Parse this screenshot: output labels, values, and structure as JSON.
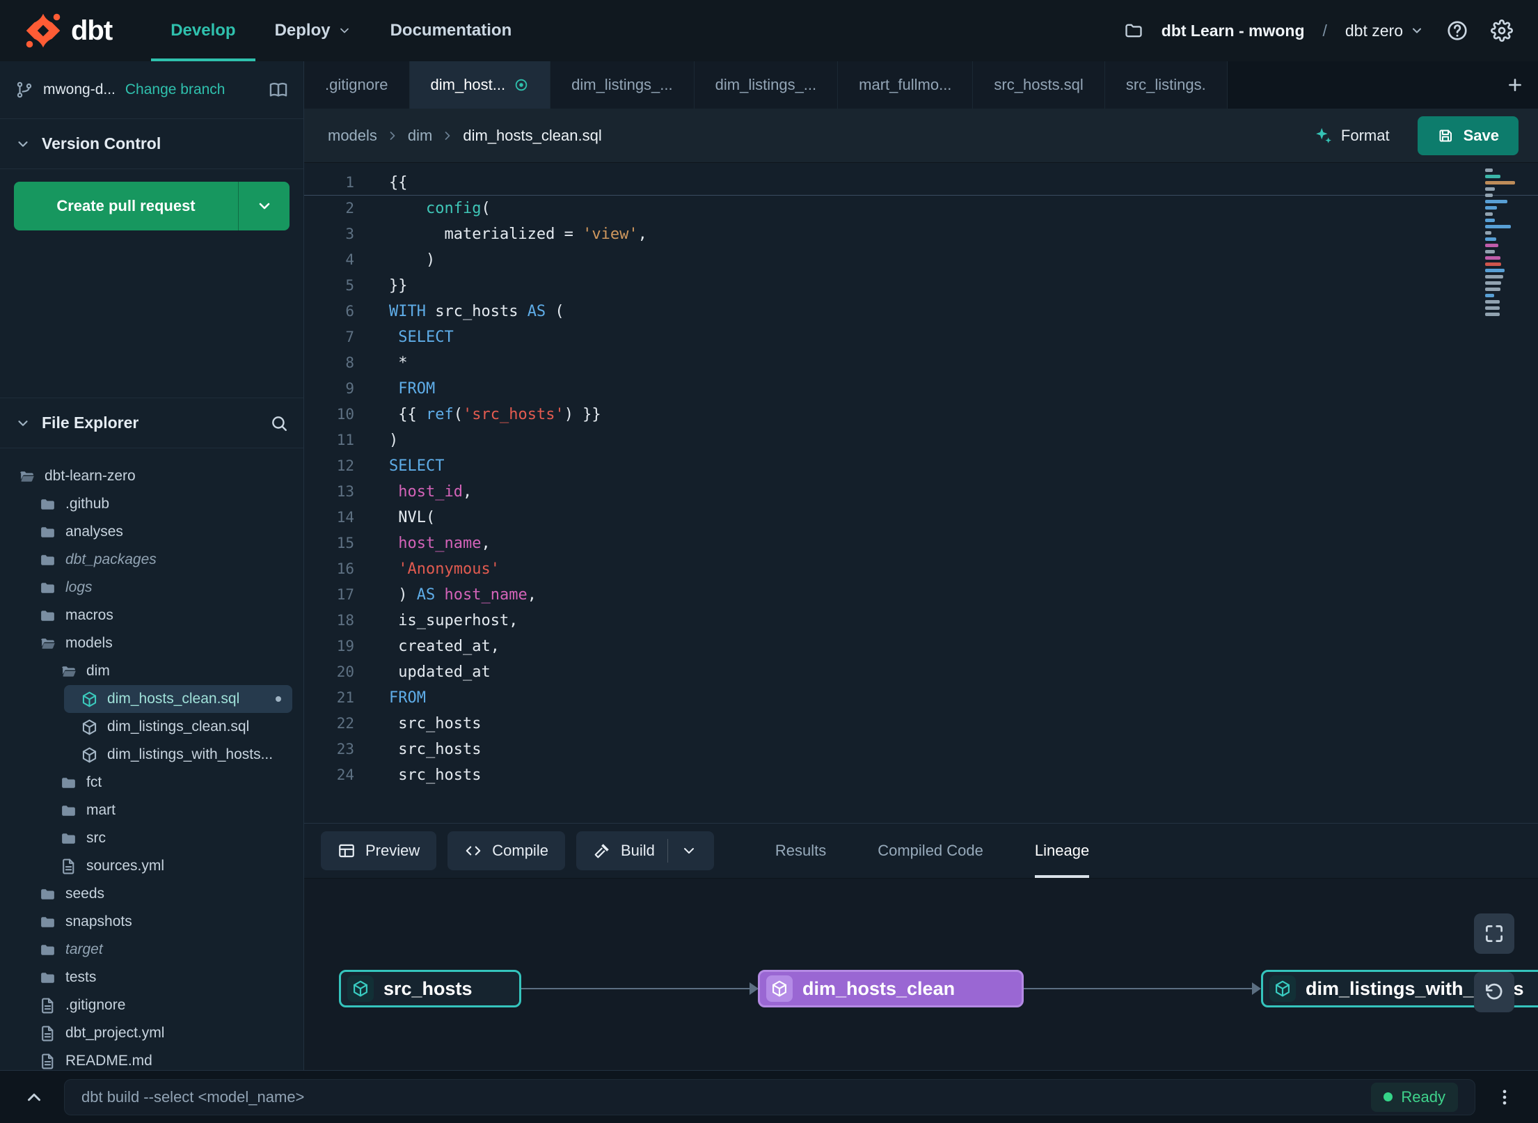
{
  "colors": {
    "accent_teal": "#2fc0ad",
    "logo_orange": "#ff5c35",
    "pr_green": "#17975f",
    "save_teal": "#0d7c6c",
    "node_purple": "#9a67d3",
    "node_teal_border": "#35c4bd",
    "ready_green": "#35d488"
  },
  "navbar": {
    "logo_text": "dbt",
    "menu": [
      {
        "label": "Develop",
        "active": true
      },
      {
        "label": "Deploy",
        "dropdown": true
      },
      {
        "label": "Documentation"
      }
    ],
    "project": "dbt Learn - mwong",
    "separator": "/",
    "env": "dbt zero"
  },
  "sidebar": {
    "branch": {
      "name": "mwong-d...",
      "change_label": "Change branch"
    },
    "version_control_label": "Version Control",
    "create_pr_label": "Create pull request",
    "file_explorer_label": "File Explorer",
    "tree": [
      {
        "label": "dbt-learn-zero",
        "type": "folder-open",
        "level": 0
      },
      {
        "label": ".github",
        "type": "folder",
        "level": 1
      },
      {
        "label": "analyses",
        "type": "folder",
        "level": 1
      },
      {
        "label": "dbt_packages",
        "type": "folder",
        "level": 1,
        "italic": true
      },
      {
        "label": "logs",
        "type": "folder",
        "level": 1,
        "italic": true
      },
      {
        "label": "macros",
        "type": "folder",
        "level": 1
      },
      {
        "label": "models",
        "type": "folder-open",
        "level": 1
      },
      {
        "label": "dim",
        "type": "folder-open",
        "level": 2
      },
      {
        "label": "dim_hosts_clean.sql",
        "type": "model",
        "level": 3,
        "selected": true,
        "modified": true
      },
      {
        "label": "dim_listings_clean.sql",
        "type": "model",
        "level": 3
      },
      {
        "label": "dim_listings_with_hosts...",
        "type": "model",
        "level": 3
      },
      {
        "label": "fct",
        "type": "folder",
        "level": 2
      },
      {
        "label": "mart",
        "type": "folder",
        "level": 2
      },
      {
        "label": "src",
        "type": "folder",
        "level": 2
      },
      {
        "label": "sources.yml",
        "type": "file",
        "level": 2
      },
      {
        "label": "seeds",
        "type": "folder",
        "level": 1
      },
      {
        "label": "snapshots",
        "type": "folder",
        "level": 1
      },
      {
        "label": "target",
        "type": "folder",
        "level": 1,
        "italic": true
      },
      {
        "label": "tests",
        "type": "folder",
        "level": 1
      },
      {
        "label": ".gitignore",
        "type": "file",
        "level": 1
      },
      {
        "label": "dbt_project.yml",
        "type": "file",
        "level": 1
      },
      {
        "label": "README.md",
        "type": "file",
        "level": 1
      }
    ]
  },
  "tabs": [
    {
      "label": ".gitignore"
    },
    {
      "label": "dim_host...",
      "active": true,
      "modified": true
    },
    {
      "label": "dim_listings_..."
    },
    {
      "label": "dim_listings_..."
    },
    {
      "label": "mart_fullmo..."
    },
    {
      "label": "src_hosts.sql"
    },
    {
      "label": "src_listings."
    }
  ],
  "breadcrumb": [
    "models",
    "dim",
    "dim_hosts_clean.sql"
  ],
  "editor_actions": {
    "format": "Format",
    "save": "Save"
  },
  "editor": {
    "current_line": 1,
    "lines": [
      {
        "n": 1,
        "tokens": [
          {
            "t": "{{",
            "c": "p"
          }
        ]
      },
      {
        "n": 2,
        "tokens": [
          {
            "t": "    ",
            "c": "p"
          },
          {
            "t": "config",
            "c": "f"
          },
          {
            "t": "(",
            "c": "p"
          }
        ]
      },
      {
        "n": 3,
        "tokens": [
          {
            "t": "      materialized = ",
            "c": "p"
          },
          {
            "t": "'view'",
            "c": "so"
          },
          {
            "t": ",",
            "c": "p"
          }
        ]
      },
      {
        "n": 4,
        "tokens": [
          {
            "t": "    )",
            "c": "p"
          }
        ]
      },
      {
        "n": 5,
        "tokens": [
          {
            "t": "}}",
            "c": "p"
          }
        ]
      },
      {
        "n": 6,
        "tokens": [
          {
            "t": "WITH",
            "c": "k"
          },
          {
            "t": " src_hosts ",
            "c": "p"
          },
          {
            "t": "AS",
            "c": "k"
          },
          {
            "t": " (",
            "c": "p"
          }
        ]
      },
      {
        "n": 7,
        "tokens": [
          {
            "t": " ",
            "c": "p"
          },
          {
            "t": "SELECT",
            "c": "k"
          }
        ]
      },
      {
        "n": 8,
        "tokens": [
          {
            "t": " *",
            "c": "p"
          }
        ]
      },
      {
        "n": 9,
        "tokens": [
          {
            "t": " ",
            "c": "p"
          },
          {
            "t": "FROM",
            "c": "k"
          }
        ]
      },
      {
        "n": 10,
        "tokens": [
          {
            "t": " {{ ",
            "c": "p"
          },
          {
            "t": "ref",
            "c": "k"
          },
          {
            "t": "(",
            "c": "p"
          },
          {
            "t": "'src_hosts'",
            "c": "sr"
          },
          {
            "t": ") }}",
            "c": "p"
          }
        ]
      },
      {
        "n": 11,
        "tokens": [
          {
            "t": ")",
            "c": "p"
          }
        ]
      },
      {
        "n": 12,
        "tokens": [
          {
            "t": "SELECT",
            "c": "k"
          }
        ]
      },
      {
        "n": 13,
        "tokens": [
          {
            "t": " ",
            "c": "p"
          },
          {
            "t": "host_id",
            "c": "id"
          },
          {
            "t": ",",
            "c": "p"
          }
        ]
      },
      {
        "n": 14,
        "tokens": [
          {
            "t": " NVL(",
            "c": "p"
          }
        ]
      },
      {
        "n": 15,
        "tokens": [
          {
            "t": " ",
            "c": "p"
          },
          {
            "t": "host_name",
            "c": "id"
          },
          {
            "t": ",",
            "c": "p"
          }
        ]
      },
      {
        "n": 16,
        "tokens": [
          {
            "t": " ",
            "c": "p"
          },
          {
            "t": "'Anonymous'",
            "c": "sr"
          }
        ]
      },
      {
        "n": 17,
        "tokens": [
          {
            "t": " ) ",
            "c": "p"
          },
          {
            "t": "AS",
            "c": "k"
          },
          {
            "t": " ",
            "c": "p"
          },
          {
            "t": "host_name",
            "c": "id"
          },
          {
            "t": ",",
            "c": "p"
          }
        ]
      },
      {
        "n": 18,
        "tokens": [
          {
            "t": " is_superhost,",
            "c": "p"
          }
        ]
      },
      {
        "n": 19,
        "tokens": [
          {
            "t": " created_at,",
            "c": "p"
          }
        ]
      },
      {
        "n": 20,
        "tokens": [
          {
            "t": " updated_at",
            "c": "p"
          }
        ]
      },
      {
        "n": 21,
        "tokens": [
          {
            "t": "FROM",
            "c": "k"
          }
        ]
      },
      {
        "n": 22,
        "tokens": [
          {
            "t": " src_hosts",
            "c": "p"
          }
        ]
      },
      {
        "n": 23,
        "tokens": [
          {
            "t": " src_hosts",
            "c": "p"
          }
        ]
      },
      {
        "n": 24,
        "tokens": [
          {
            "t": " src_hosts",
            "c": "p"
          }
        ]
      }
    ]
  },
  "bottom_panel": {
    "buttons": [
      {
        "label": "Preview",
        "icon": "table"
      },
      {
        "label": "Compile",
        "icon": "code"
      },
      {
        "label": "Build",
        "icon": "hammer",
        "split": true
      }
    ],
    "tabs": [
      {
        "label": "Results"
      },
      {
        "label": "Compiled Code"
      },
      {
        "label": "Lineage",
        "active": true
      }
    ],
    "lineage": {
      "nodes": [
        {
          "label": "src_hosts",
          "style": "teal"
        },
        {
          "label": "dim_hosts_clean",
          "style": "purple"
        },
        {
          "label": "dim_listings_with_hosts",
          "style": "teal"
        }
      ]
    }
  },
  "statusbar": {
    "command": "dbt build --select <model_name>",
    "status": "Ready"
  }
}
